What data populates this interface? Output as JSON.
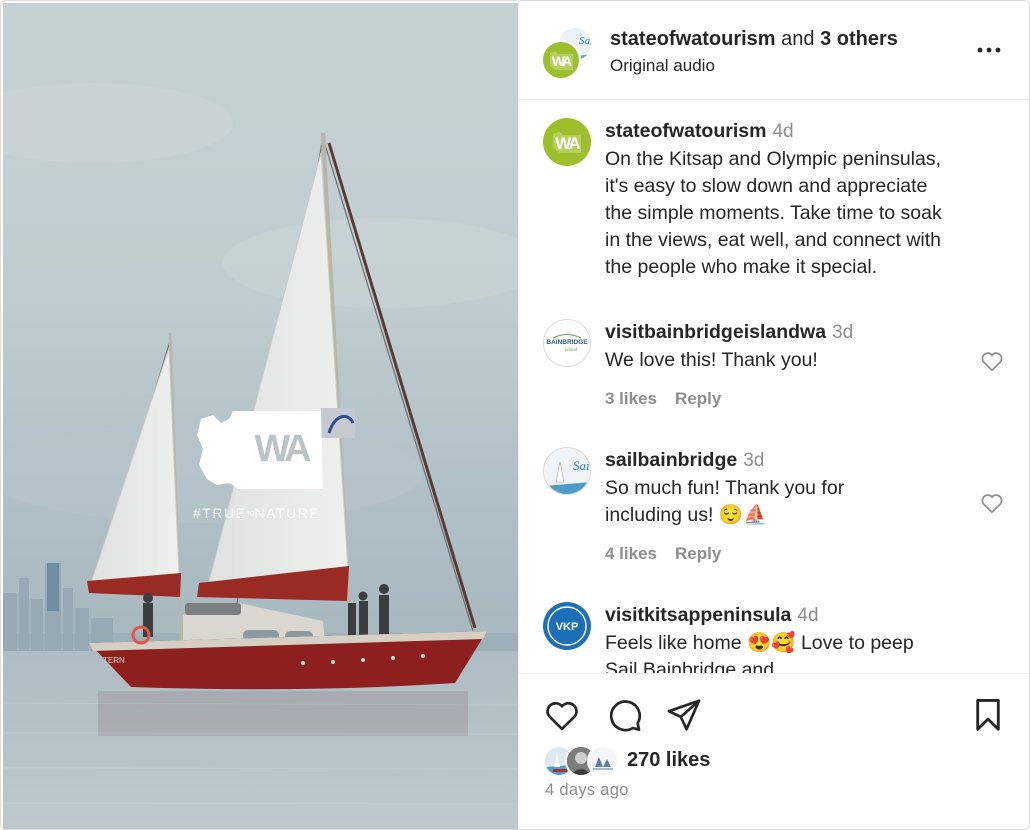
{
  "media": {
    "wa_logo_text": "WA",
    "hashtag_main": "#TRUE",
    "hashtag_small": "TO",
    "hashtag_end": "NATURE",
    "boat_name": "TERN"
  },
  "header": {
    "username": "stateofwatourism",
    "joiner": " and ",
    "others": "3 others",
    "audio": "Original audio",
    "avatar_text": "WA",
    "avatar_back_text": "Sail"
  },
  "caption": {
    "username": "stateofwatourism",
    "time": "4d",
    "avatar_text": "WA",
    "lines": [
      "On the Kitsap and Olympic peninsulas,",
      "it's easy to slow down and appreciate",
      "the simple moments. Take time to soak",
      "in the views, eat well, and connect with",
      "the people who make it special."
    ]
  },
  "comments": [
    {
      "username": "visitbainbridgeislandwa",
      "time": "3d",
      "avatar_text": "BAINBRIDGE",
      "avatar_sub": "island",
      "lines": [
        "We love this! Thank you!"
      ],
      "likes": "3 likes",
      "reply": "Reply"
    },
    {
      "username": "sailbainbridge",
      "time": "3d",
      "avatar_text": "Sail",
      "lines": [
        "So much fun! Thank you for",
        "including us! 😌⛵"
      ],
      "likes": "4 likes",
      "reply": "Reply"
    },
    {
      "username": "visitkitsappeninsula",
      "time": "4d",
      "avatar_text": "VKP",
      "lines": [
        "Feels like home 😍🥰 Love to peep",
        "Sail Bainbridge and"
      ]
    }
  ],
  "actions": {
    "icons": [
      "heart-icon",
      "comment-icon",
      "share-icon",
      "bookmark-icon"
    ],
    "likes": "270 likes",
    "date": "4 days ago"
  },
  "colors": {
    "wa_green": "#9cbf2b",
    "vkp_blue": "#1d6fb8",
    "text": "#262626",
    "muted": "#8e8e8e",
    "hull_red": "#8e1f1f"
  }
}
